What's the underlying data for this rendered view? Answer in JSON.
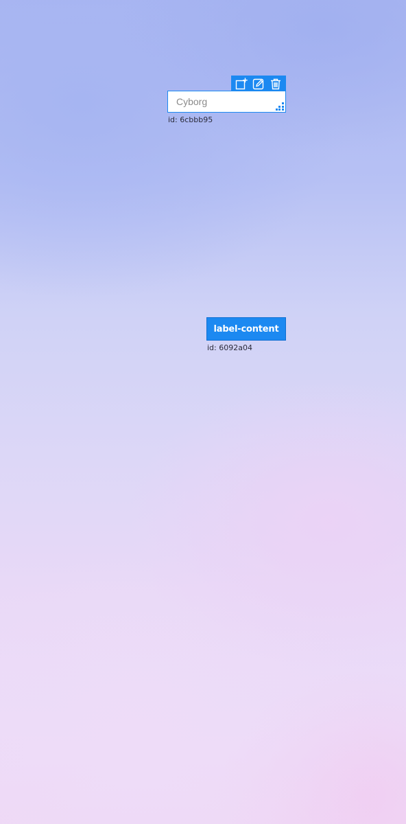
{
  "widgets": [
    {
      "kind": "input",
      "placeholder": "Cyborg",
      "id_label": "id: 6cbbb95",
      "toolbar": {
        "icons": [
          "add-icon",
          "edit-icon",
          "delete-icon"
        ]
      }
    },
    {
      "kind": "button",
      "label": "label-content",
      "id_label": "id: 6092a04"
    }
  ],
  "colors": {
    "accent": "#1c89f1",
    "text": "#2b2b3a",
    "placeholder": "#8a8a8a"
  }
}
